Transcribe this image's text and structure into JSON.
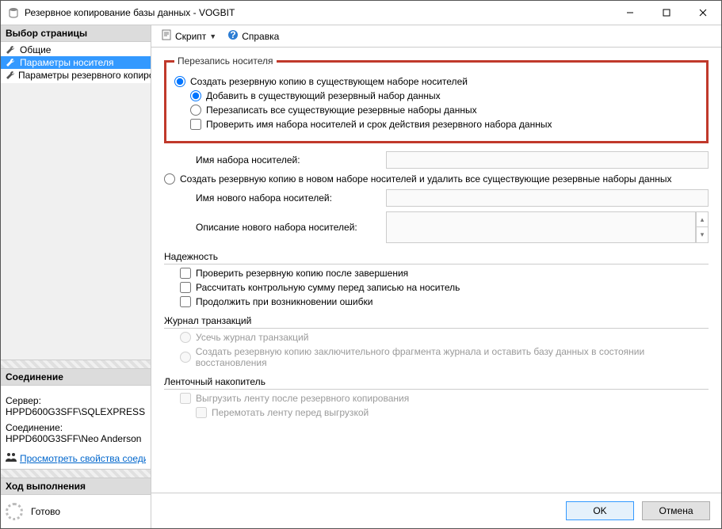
{
  "window": {
    "title": "Резервное копирование базы данных - VOGBIT"
  },
  "sidebar": {
    "page_select_header": "Выбор страницы",
    "items": [
      {
        "label": "Общие"
      },
      {
        "label": "Параметры носителя"
      },
      {
        "label": "Параметры резервного копирования"
      }
    ],
    "connection_header": "Соединение",
    "server_label": "Сервер:",
    "server_value": "HPPD600G3SFF\\SQLEXPRESS",
    "conn_label": "Соединение:",
    "conn_value": "HPPD600G3SFF\\Neo Anderson",
    "view_props": "Просмотреть свойства соединения",
    "progress_header": "Ход выполнения",
    "progress_status": "Готово"
  },
  "toolbar": {
    "script": "Скрипт",
    "help": "Справка"
  },
  "media": {
    "legend": "Перезапись носителя",
    "opt_existing": "Создать резервную копию в существующем наборе носителей",
    "sub_append": "Добавить в существующий резервный набор данных",
    "sub_overwrite": "Перезаписать все существующие резервные наборы данных",
    "chk_verify_name": "Проверить имя набора носителей и срок действия резервного набора данных",
    "media_name_label": "Имя набора носителей:",
    "opt_new": "Создать резервную копию в новом наборе носителей и удалить все существующие резервные наборы данных",
    "new_name_label": "Имя нового набора носителей:",
    "new_desc_label": "Описание нового набора носителей:"
  },
  "reliability": {
    "legend": "Надежность",
    "chk_verify": "Проверить резервную копию после завершения",
    "chk_checksum": "Рассчитать контрольную сумму перед записью на носитель",
    "chk_continue": "Продолжить при возникновении ошибки"
  },
  "txlog": {
    "legend": "Журнал транзакций",
    "opt_truncate": "Усечь журнал транзакций",
    "opt_tail": "Создать резервную копию заключительного фрагмента журнала и оставить базу данных в состоянии восстановления"
  },
  "tape": {
    "legend": "Ленточный накопитель",
    "chk_unload": "Выгрузить ленту после резервного копирования",
    "chk_rewind": "Перемотать ленту перед выгрузкой"
  },
  "footer": {
    "ok": "OK",
    "cancel": "Отмена"
  }
}
